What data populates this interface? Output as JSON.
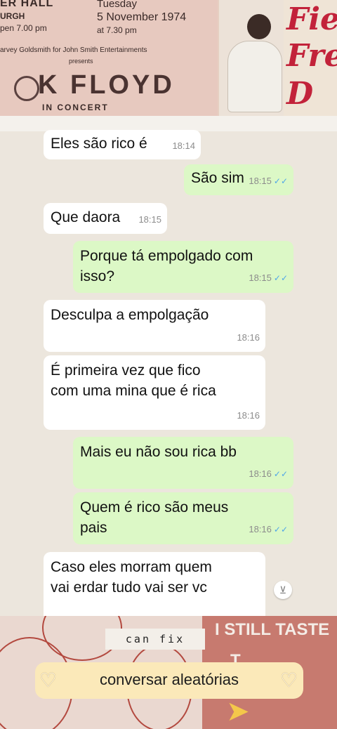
{
  "ticket": {
    "hall": "ER HALL",
    "city": "URGH",
    "open": "pen 7.00 pm",
    "day": "Tuesday",
    "date": "5 November 1974",
    "time": "at 7.30 pm",
    "promoter": "arvey Goldsmith for John Smith Entertainments",
    "presents": "presents",
    "band": "K FLOYD",
    "concert": "IN CONCERT"
  },
  "red_text": [
    "Fiel",
    "Frei",
    "D"
  ],
  "chat": {
    "messages": [
      {
        "dir": "in",
        "lines": [
          "Eles são rico é"
        ],
        "time": "18:14"
      },
      {
        "dir": "out",
        "lines": [
          "São sim"
        ],
        "time": "18:15"
      },
      {
        "dir": "in",
        "lines": [
          "Que daora"
        ],
        "time": "18:15"
      },
      {
        "dir": "out",
        "lines": [
          "Porque tá empolgado com",
          "isso?"
        ],
        "time": "18:15"
      },
      {
        "dir": "in",
        "lines": [
          "Desculpa a empolgação"
        ],
        "time": "18:16"
      },
      {
        "dir": "in",
        "lines": [
          "É primeira vez que fico",
          "com uma mina que é rica"
        ],
        "time": "18:16"
      },
      {
        "dir": "out",
        "lines": [
          "Mais eu não sou rica bb"
        ],
        "time": "18:16"
      },
      {
        "dir": "out",
        "lines": [
          "Quem é rico são meus",
          "pais"
        ],
        "time": "18:16"
      },
      {
        "dir": "in",
        "lines": [
          "Caso eles morram quem",
          "vai erdar tudo vai ser vc"
        ],
        "time": ""
      }
    ],
    "read_tick": "✓✓",
    "scroll_icon": "chevron-double-down-icon"
  },
  "bottom": {
    "sticker": "can fix",
    "poster_line1": "I STILL TASTE",
    "poster_line2": "T",
    "pill_label": "conversar aleatórias",
    "colors": {
      "pill": "#fbe9b9",
      "out_bubble": "#dcf8c6",
      "in_bubble": "#ffffff",
      "tick": "#4fa6e8"
    }
  }
}
